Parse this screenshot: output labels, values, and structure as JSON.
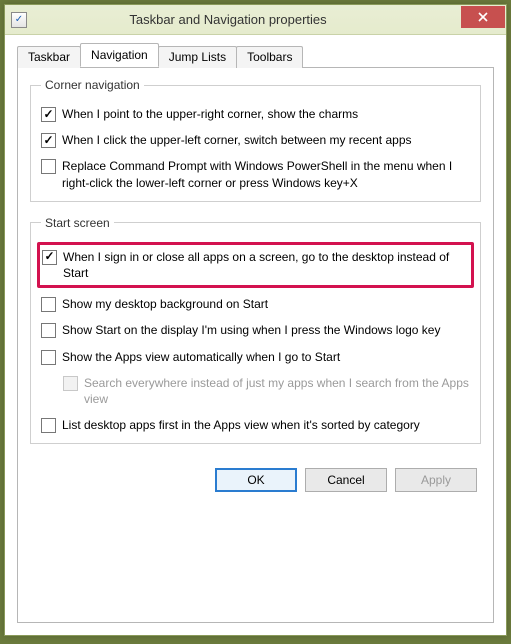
{
  "window": {
    "title": "Taskbar and Navigation properties"
  },
  "tabs": {
    "taskbar": "Taskbar",
    "navigation": "Navigation",
    "jumplists": "Jump Lists",
    "toolbars": "Toolbars",
    "active": "navigation"
  },
  "groups": {
    "corner": {
      "legend": "Corner navigation",
      "opt_charms": {
        "checked": true,
        "label": "When I point to the upper-right corner, show the charms"
      },
      "opt_switch": {
        "checked": true,
        "label": "When I click the upper-left corner, switch between my recent apps"
      },
      "opt_powershell": {
        "checked": false,
        "label": "Replace Command Prompt with Windows PowerShell in the menu when I right-click the lower-left corner or press Windows key+X"
      }
    },
    "start": {
      "legend": "Start screen",
      "opt_desktop": {
        "checked": true,
        "label": "When I sign in or close all apps on a screen, go to the desktop instead of Start",
        "highlighted": true
      },
      "opt_bg": {
        "checked": false,
        "label": "Show my desktop background on Start"
      },
      "opt_display": {
        "checked": false,
        "label": "Show Start on the display I'm using when I press the Windows logo key"
      },
      "opt_appsview": {
        "checked": false,
        "label": "Show the Apps view automatically when I go to Start"
      },
      "opt_search": {
        "checked": false,
        "disabled": true,
        "label": "Search everywhere instead of just my apps when I search from the Apps view"
      },
      "opt_listdesktop": {
        "checked": false,
        "label": "List desktop apps first in the Apps view when it's sorted by category"
      }
    }
  },
  "buttons": {
    "ok": "OK",
    "cancel": "Cancel",
    "apply": "Apply"
  }
}
